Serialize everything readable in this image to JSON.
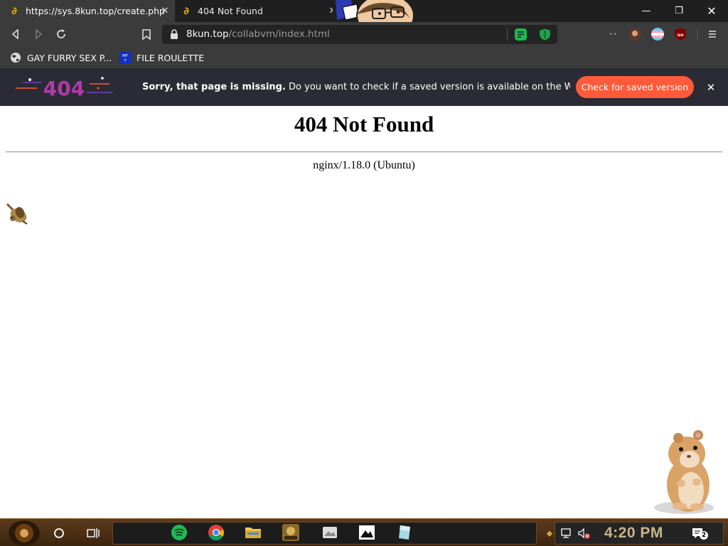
{
  "tabs": [
    {
      "title": "https://sys.8kun.top/create.php",
      "favicon": "paperclip-icon",
      "active": true
    },
    {
      "title": "404 Not Found",
      "favicon": "paperclip-icon",
      "active": false
    }
  ],
  "window_controls": {
    "minimize": "minimize-icon",
    "restore": "restore-icon",
    "close": "close-icon"
  },
  "address_bar": {
    "host": "8kun.top",
    "path": "/collabvm/index.html"
  },
  "bookmarks": [
    {
      "label": "GAY FURRY SEX P...",
      "icon": "globe-icon"
    },
    {
      "label": "FILE ROULETTE",
      "icon": "mf-favicon-icon",
      "icon_text": "MF\nT"
    }
  ],
  "wayback_notice": {
    "logo_text": "404",
    "bold_text": "Sorry, that page is missing.",
    "text": " Do you want to check if a saved version is available on the Wayback...",
    "button_label": "Check for saved version",
    "accent_color": "#ff5b3a"
  },
  "page": {
    "heading": "404 Not Found",
    "server": "nginx/1.18.0 (Ubuntu)"
  },
  "taskbar": {
    "clock": "4:20 PM",
    "notification_count": "2",
    "apps": [
      "spotify-icon",
      "chrome-icon",
      "file-explorer-icon",
      "game-icon",
      "photo-app-icon",
      "image-viewer-icon",
      "ice-app-icon"
    ]
  }
}
